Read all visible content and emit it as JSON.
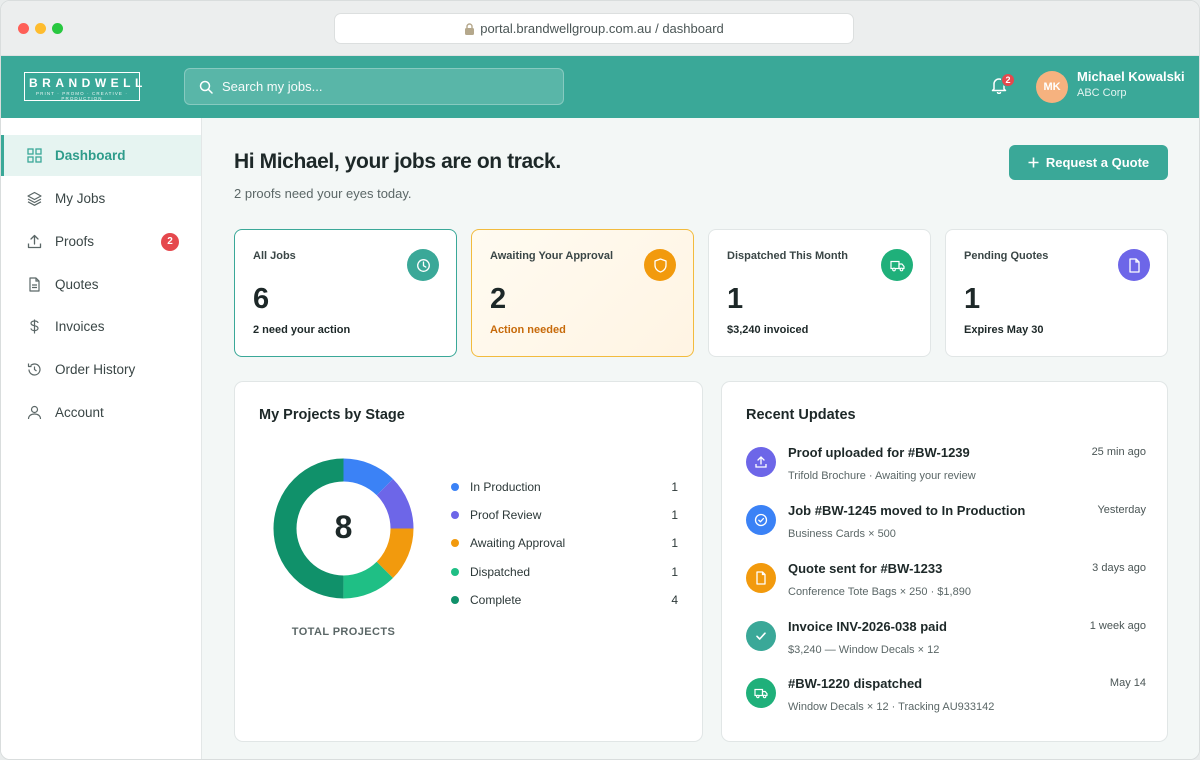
{
  "browser": {
    "url": "portal.brandwellgroup.com.au / dashboard"
  },
  "header": {
    "logo_word": "BRANDWELL",
    "logo_tag": "PRINT · PROMO · CREATIVE · PRODUCTION",
    "search_placeholder": "Search my jobs...",
    "notification_count": "2",
    "user_initials": "MK",
    "user_name": "Michael Kowalski",
    "user_company": "ABC Corp"
  },
  "sidebar": {
    "items": [
      {
        "label": "Dashboard",
        "icon": "grid-icon",
        "active": true
      },
      {
        "label": "My Jobs",
        "icon": "layers-icon"
      },
      {
        "label": "Proofs",
        "icon": "upload-icon",
        "badge": "2"
      },
      {
        "label": "Quotes",
        "icon": "document-icon"
      },
      {
        "label": "Invoices",
        "icon": "dollar-icon"
      },
      {
        "label": "Order History",
        "icon": "history-icon"
      },
      {
        "label": "Account",
        "icon": "user-icon"
      }
    ]
  },
  "main": {
    "greeting": "Hi Michael, your jobs are on track.",
    "sub_greeting": "2 proofs need your eyes today.",
    "quote_button": "Request a Quote"
  },
  "stats": [
    {
      "label": "All Jobs",
      "value": "6",
      "note": "2 need your action",
      "icon": "clock-icon",
      "color": "#3aa898"
    },
    {
      "label": "Awaiting Your Approval",
      "value": "2",
      "note": "Action needed",
      "icon": "shield-icon",
      "color": "#f29a0d"
    },
    {
      "label": "Dispatched This Month",
      "value": "1",
      "note": "$3,240 invoiced",
      "icon": "truck-icon",
      "color": "#1fb07a"
    },
    {
      "label": "Pending Quotes",
      "value": "1",
      "note": "Expires May 30",
      "icon": "document-icon",
      "color": "#6d66e8"
    }
  ],
  "projects": {
    "title": "My Projects by Stage",
    "total": "8",
    "total_caption": "TOTAL PROJECTS",
    "stages": [
      {
        "label": "In Production",
        "count": "1",
        "color": "#3b82f6"
      },
      {
        "label": "Proof Review",
        "count": "1",
        "color": "#6d66e8"
      },
      {
        "label": "Awaiting Approval",
        "count": "1",
        "color": "#f29a0d"
      },
      {
        "label": "Dispatched",
        "count": "1",
        "color": "#1fbf85"
      },
      {
        "label": "Complete",
        "count": "4",
        "color": "#10916a"
      }
    ]
  },
  "chart_data": {
    "type": "pie",
    "title": "My Projects by Stage",
    "categories": [
      "In Production",
      "Proof Review",
      "Awaiting Approval",
      "Dispatched",
      "Complete"
    ],
    "values": [
      1,
      1,
      1,
      1,
      4
    ]
  },
  "updates": {
    "title": "Recent Updates",
    "items": [
      {
        "title": "Proof uploaded for #BW-1239",
        "sub": "Trifold Brochure · Awaiting your review",
        "time": "25 min ago",
        "icon": "upload-icon",
        "color": "#6d66e8"
      },
      {
        "title": "Job #BW-1245 moved to In Production",
        "sub": "Business Cards × 500",
        "time": "Yesterday",
        "icon": "gauge-icon",
        "color": "#3b82f6"
      },
      {
        "title": "Quote sent for #BW-1233",
        "sub": "Conference Tote Bags × 250 · $1,890",
        "time": "3 days ago",
        "icon": "document-icon",
        "color": "#f29a0d"
      },
      {
        "title": "Invoice INV-2026-038 paid",
        "sub": "$3,240 — Window Decals × 12",
        "time": "1 week ago",
        "icon": "check-icon",
        "color": "#3aa898"
      },
      {
        "title": "#BW-1220 dispatched",
        "sub": "Window Decals × 12 · Tracking AU933142",
        "time": "May 14",
        "icon": "truck-icon",
        "color": "#1fb07a"
      }
    ]
  }
}
